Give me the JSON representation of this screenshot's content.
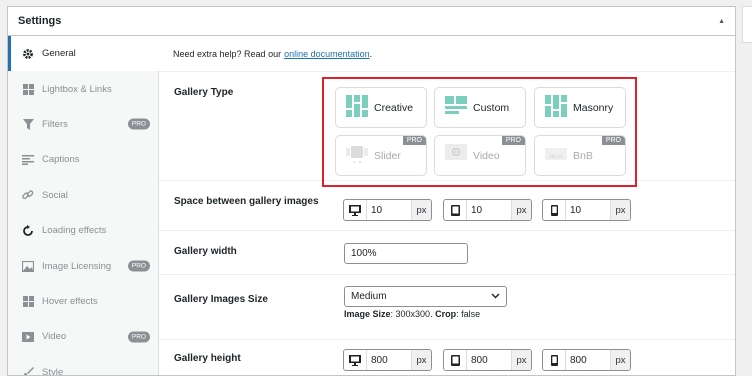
{
  "panel": {
    "title": "Settings"
  },
  "sidebar": {
    "items": [
      {
        "label": "General",
        "icon": "gear-icon",
        "pro": false,
        "active": true
      },
      {
        "label": "Lightbox & Links",
        "icon": "grid-icon",
        "pro": false
      },
      {
        "label": "Filters",
        "icon": "funnel-icon",
        "pro": true
      },
      {
        "label": "Captions",
        "icon": "lines-icon",
        "pro": false
      },
      {
        "label": "Social",
        "icon": "link-icon",
        "pro": false
      },
      {
        "label": "Loading effects",
        "icon": "refresh-icon",
        "pro": false
      },
      {
        "label": "Image Licensing",
        "icon": "image-icon",
        "pro": true
      },
      {
        "label": "Hover effects",
        "icon": "grid-icon",
        "pro": false
      },
      {
        "label": "Video",
        "icon": "play-icon",
        "pro": true
      },
      {
        "label": "Style",
        "icon": "brush-icon",
        "pro": false
      }
    ],
    "pro_label": "PRO"
  },
  "help": {
    "text": "Need extra help? Read our",
    "link": "online documentation",
    "suffix": "."
  },
  "gallery_type": {
    "label": "Gallery Type",
    "options": [
      {
        "label": "Creative",
        "pro": false
      },
      {
        "label": "Custom",
        "pro": false
      },
      {
        "label": "Masonry",
        "pro": false
      },
      {
        "label": "Slider",
        "pro": true
      },
      {
        "label": "Video",
        "pro": true
      },
      {
        "label": "BnB",
        "pro": true
      }
    ],
    "pro_label": "PRO"
  },
  "spacing": {
    "label": "Space between gallery images",
    "desktop": "10",
    "tablet": "10",
    "mobile": "10",
    "unit": "px"
  },
  "width": {
    "label": "Gallery width",
    "value": "100%"
  },
  "images_size": {
    "label": "Gallery Images Size",
    "selected": "Medium",
    "note_label1": "Image Size",
    "note_value1": ": 300x300.",
    "note_label2": "Crop",
    "note_value2": ": false"
  },
  "height": {
    "label": "Gallery height",
    "desktop": "800",
    "tablet": "800",
    "mobile": "800",
    "unit": "px"
  },
  "colors": {
    "accent": "#2271b1",
    "highlight": "#e0212c",
    "pro": "#8c8f94",
    "tile_green": "#7ccfbc"
  }
}
